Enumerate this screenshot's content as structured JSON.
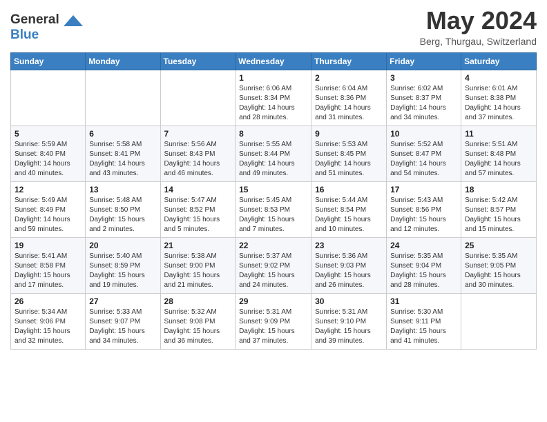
{
  "logo": {
    "line1": "General",
    "line2": "Blue"
  },
  "title": "May 2024",
  "subtitle": "Berg, Thurgau, Switzerland",
  "days_header": [
    "Sunday",
    "Monday",
    "Tuesday",
    "Wednesday",
    "Thursday",
    "Friday",
    "Saturday"
  ],
  "weeks": [
    [
      {
        "num": "",
        "sunrise": "",
        "sunset": "",
        "daylight": ""
      },
      {
        "num": "",
        "sunrise": "",
        "sunset": "",
        "daylight": ""
      },
      {
        "num": "",
        "sunrise": "",
        "sunset": "",
        "daylight": ""
      },
      {
        "num": "1",
        "sunrise": "Sunrise: 6:06 AM",
        "sunset": "Sunset: 8:34 PM",
        "daylight": "Daylight: 14 hours and 28 minutes."
      },
      {
        "num": "2",
        "sunrise": "Sunrise: 6:04 AM",
        "sunset": "Sunset: 8:36 PM",
        "daylight": "Daylight: 14 hours and 31 minutes."
      },
      {
        "num": "3",
        "sunrise": "Sunrise: 6:02 AM",
        "sunset": "Sunset: 8:37 PM",
        "daylight": "Daylight: 14 hours and 34 minutes."
      },
      {
        "num": "4",
        "sunrise": "Sunrise: 6:01 AM",
        "sunset": "Sunset: 8:38 PM",
        "daylight": "Daylight: 14 hours and 37 minutes."
      }
    ],
    [
      {
        "num": "5",
        "sunrise": "Sunrise: 5:59 AM",
        "sunset": "Sunset: 8:40 PM",
        "daylight": "Daylight: 14 hours and 40 minutes."
      },
      {
        "num": "6",
        "sunrise": "Sunrise: 5:58 AM",
        "sunset": "Sunset: 8:41 PM",
        "daylight": "Daylight: 14 hours and 43 minutes."
      },
      {
        "num": "7",
        "sunrise": "Sunrise: 5:56 AM",
        "sunset": "Sunset: 8:43 PM",
        "daylight": "Daylight: 14 hours and 46 minutes."
      },
      {
        "num": "8",
        "sunrise": "Sunrise: 5:55 AM",
        "sunset": "Sunset: 8:44 PM",
        "daylight": "Daylight: 14 hours and 49 minutes."
      },
      {
        "num": "9",
        "sunrise": "Sunrise: 5:53 AM",
        "sunset": "Sunset: 8:45 PM",
        "daylight": "Daylight: 14 hours and 51 minutes."
      },
      {
        "num": "10",
        "sunrise": "Sunrise: 5:52 AM",
        "sunset": "Sunset: 8:47 PM",
        "daylight": "Daylight: 14 hours and 54 minutes."
      },
      {
        "num": "11",
        "sunrise": "Sunrise: 5:51 AM",
        "sunset": "Sunset: 8:48 PM",
        "daylight": "Daylight: 14 hours and 57 minutes."
      }
    ],
    [
      {
        "num": "12",
        "sunrise": "Sunrise: 5:49 AM",
        "sunset": "Sunset: 8:49 PM",
        "daylight": "Daylight: 14 hours and 59 minutes."
      },
      {
        "num": "13",
        "sunrise": "Sunrise: 5:48 AM",
        "sunset": "Sunset: 8:50 PM",
        "daylight": "Daylight: 15 hours and 2 minutes."
      },
      {
        "num": "14",
        "sunrise": "Sunrise: 5:47 AM",
        "sunset": "Sunset: 8:52 PM",
        "daylight": "Daylight: 15 hours and 5 minutes."
      },
      {
        "num": "15",
        "sunrise": "Sunrise: 5:45 AM",
        "sunset": "Sunset: 8:53 PM",
        "daylight": "Daylight: 15 hours and 7 minutes."
      },
      {
        "num": "16",
        "sunrise": "Sunrise: 5:44 AM",
        "sunset": "Sunset: 8:54 PM",
        "daylight": "Daylight: 15 hours and 10 minutes."
      },
      {
        "num": "17",
        "sunrise": "Sunrise: 5:43 AM",
        "sunset": "Sunset: 8:56 PM",
        "daylight": "Daylight: 15 hours and 12 minutes."
      },
      {
        "num": "18",
        "sunrise": "Sunrise: 5:42 AM",
        "sunset": "Sunset: 8:57 PM",
        "daylight": "Daylight: 15 hours and 15 minutes."
      }
    ],
    [
      {
        "num": "19",
        "sunrise": "Sunrise: 5:41 AM",
        "sunset": "Sunset: 8:58 PM",
        "daylight": "Daylight: 15 hours and 17 minutes."
      },
      {
        "num": "20",
        "sunrise": "Sunrise: 5:40 AM",
        "sunset": "Sunset: 8:59 PM",
        "daylight": "Daylight: 15 hours and 19 minutes."
      },
      {
        "num": "21",
        "sunrise": "Sunrise: 5:38 AM",
        "sunset": "Sunset: 9:00 PM",
        "daylight": "Daylight: 15 hours and 21 minutes."
      },
      {
        "num": "22",
        "sunrise": "Sunrise: 5:37 AM",
        "sunset": "Sunset: 9:02 PM",
        "daylight": "Daylight: 15 hours and 24 minutes."
      },
      {
        "num": "23",
        "sunrise": "Sunrise: 5:36 AM",
        "sunset": "Sunset: 9:03 PM",
        "daylight": "Daylight: 15 hours and 26 minutes."
      },
      {
        "num": "24",
        "sunrise": "Sunrise: 5:35 AM",
        "sunset": "Sunset: 9:04 PM",
        "daylight": "Daylight: 15 hours and 28 minutes."
      },
      {
        "num": "25",
        "sunrise": "Sunrise: 5:35 AM",
        "sunset": "Sunset: 9:05 PM",
        "daylight": "Daylight: 15 hours and 30 minutes."
      }
    ],
    [
      {
        "num": "26",
        "sunrise": "Sunrise: 5:34 AM",
        "sunset": "Sunset: 9:06 PM",
        "daylight": "Daylight: 15 hours and 32 minutes."
      },
      {
        "num": "27",
        "sunrise": "Sunrise: 5:33 AM",
        "sunset": "Sunset: 9:07 PM",
        "daylight": "Daylight: 15 hours and 34 minutes."
      },
      {
        "num": "28",
        "sunrise": "Sunrise: 5:32 AM",
        "sunset": "Sunset: 9:08 PM",
        "daylight": "Daylight: 15 hours and 36 minutes."
      },
      {
        "num": "29",
        "sunrise": "Sunrise: 5:31 AM",
        "sunset": "Sunset: 9:09 PM",
        "daylight": "Daylight: 15 hours and 37 minutes."
      },
      {
        "num": "30",
        "sunrise": "Sunrise: 5:31 AM",
        "sunset": "Sunset: 9:10 PM",
        "daylight": "Daylight: 15 hours and 39 minutes."
      },
      {
        "num": "31",
        "sunrise": "Sunrise: 5:30 AM",
        "sunset": "Sunset: 9:11 PM",
        "daylight": "Daylight: 15 hours and 41 minutes."
      },
      {
        "num": "",
        "sunrise": "",
        "sunset": "",
        "daylight": ""
      }
    ]
  ]
}
